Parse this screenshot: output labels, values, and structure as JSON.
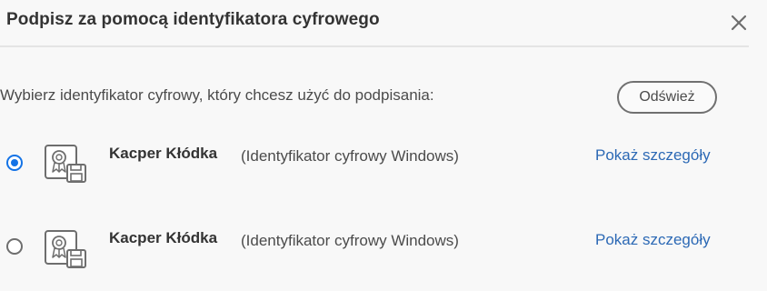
{
  "dialog": {
    "title": "Podpisz za pomocą identyfikatora cyfrowego",
    "close_icon": "close-icon",
    "prompt": "Wybierz identyfikator cyfrowy, który chcesz użyć do podpisania:",
    "refresh_label": "Odśwież"
  },
  "identities": [
    {
      "name": "Kacper Kłódka",
      "type": "(Identyfikator cyfrowy Windows)",
      "details_label": "Pokaż szczegóły",
      "selected": true,
      "icon": "certificate-icon"
    },
    {
      "name": "Kacper Kłódka",
      "type": "(Identyfikator cyfrowy Windows)",
      "details_label": "Pokaż szczegóły",
      "selected": false,
      "icon": "certificate-icon"
    }
  ],
  "colors": {
    "accent": "#1473e6",
    "link": "#2c69b5",
    "background": "#f8f8f8"
  }
}
